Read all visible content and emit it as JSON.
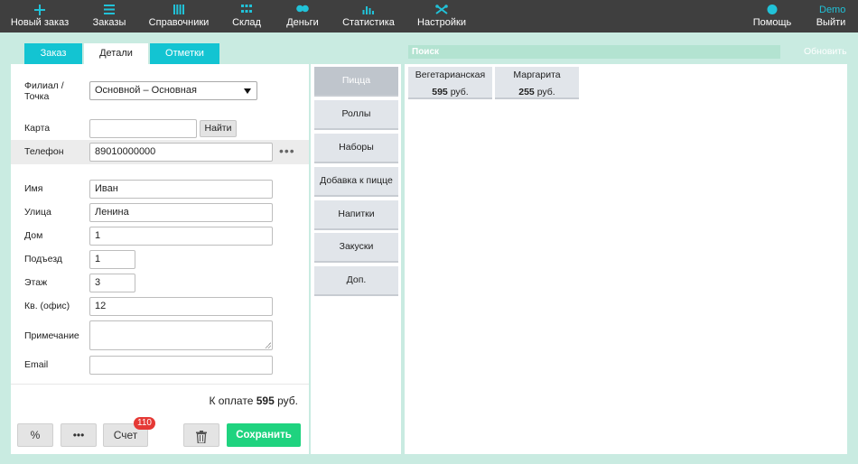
{
  "nav": {
    "items": [
      {
        "label": "Новый заказ",
        "icon": "plus-icon"
      },
      {
        "label": "Заказы",
        "icon": "list-icon"
      },
      {
        "label": "Справочники",
        "icon": "books-icon"
      },
      {
        "label": "Склад",
        "icon": "grid-icon"
      },
      {
        "label": "Деньги",
        "icon": "coins-icon"
      },
      {
        "label": "Статистика",
        "icon": "bar-chart-icon"
      },
      {
        "label": "Настройки",
        "icon": "tools-icon"
      }
    ],
    "help": {
      "label": "Помощь",
      "icon_text": "?"
    },
    "user": "Demo",
    "logout": "Выйти"
  },
  "tabs": [
    {
      "label": "Заказ",
      "active": false
    },
    {
      "label": "Детали",
      "active": true
    },
    {
      "label": "Отметки",
      "active": false
    }
  ],
  "form": {
    "branch_label": "Филиал /",
    "branch_label2": "Точка",
    "branch_value": "Основной – Основная",
    "card_label": "Карта",
    "card_value": "",
    "find_button": "Найти",
    "phone_label": "Телефон",
    "phone_value": "89010000000",
    "more_dots": "•••",
    "name_label": "Имя",
    "name_value": "Иван",
    "street_label": "Улица",
    "street_value": "Ленина",
    "house_label": "Дом",
    "house_value": "1",
    "entrance_label": "Подъезд",
    "entrance_value": "1",
    "floor_label": "Этаж",
    "floor_value": "3",
    "apt_label": "Кв. (офис)",
    "apt_value": "12",
    "note_label": "Примечание",
    "note_value": "",
    "email_label": "Email",
    "email_value": ""
  },
  "totals": {
    "label": "К оплате",
    "amount": "595",
    "currency": "руб."
  },
  "footer": {
    "percent": "%",
    "more": "•••",
    "bill": "Счет",
    "bill_badge": "110",
    "save": "Сохранить"
  },
  "categories": [
    {
      "label": "Пицца",
      "active": true
    },
    {
      "label": "Роллы",
      "active": false
    },
    {
      "label": "Наборы",
      "active": false
    },
    {
      "label": "Добавка к пицце",
      "active": false
    },
    {
      "label": "Напитки",
      "active": false
    },
    {
      "label": "Закуски",
      "active": false
    },
    {
      "label": "Доп.",
      "active": false
    }
  ],
  "search": {
    "placeholder": "Поиск"
  },
  "refresh": "Обновить",
  "products": [
    {
      "name": "Вегетарианская",
      "price": "595",
      "currency": "руб."
    },
    {
      "name": "Маргарита",
      "price": "255",
      "currency": "руб."
    }
  ],
  "colors": {
    "accent": "#21c2d8",
    "topbar": "#3f3f3f",
    "background": "#c9ebe1",
    "save": "#1fd37f",
    "badge": "#e53935"
  }
}
